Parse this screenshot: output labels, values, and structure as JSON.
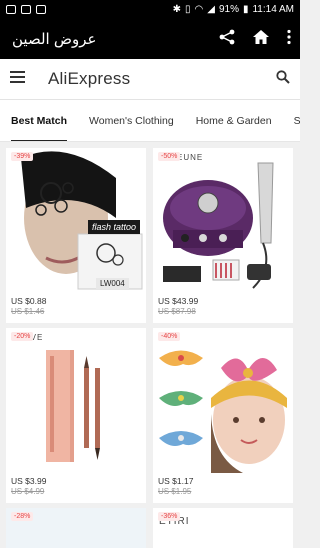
{
  "status_bar": {
    "battery": "91%",
    "time": "11:14 AM"
  },
  "app_bar": {
    "title": "عروض الصين"
  },
  "ali_header": {
    "brand": "AliExpress"
  },
  "tabs": [
    {
      "label": "Best Match"
    },
    {
      "label": "Women's Clothing"
    },
    {
      "label": "Home & Garden"
    },
    {
      "label": "Sp"
    }
  ],
  "products": [
    {
      "badge": "-39%",
      "price": "US $0.88",
      "old_price": "US $1.46",
      "overlay": "flash tattoo",
      "code": "LW004"
    },
    {
      "badge": "-50%",
      "price": "US $43.99",
      "old_price": "US $87.98",
      "brand": "EUNE"
    },
    {
      "badge": "-20%",
      "price": "US $3.99",
      "old_price": "US $4.99",
      "brand": "D LIVE"
    },
    {
      "badge": "-40%",
      "price": "US $1.17",
      "old_price": "US $1.95"
    },
    {
      "badge": "-28%"
    },
    {
      "badge": "-36%",
      "brand": "ETIRI"
    }
  ],
  "colors": {
    "app_bar": "#000000",
    "badge_text": "#e64545",
    "accent": "#222222"
  }
}
